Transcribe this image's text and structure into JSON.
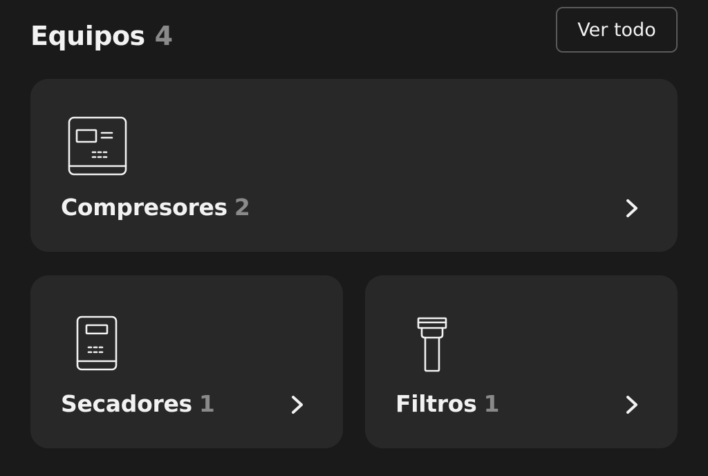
{
  "header": {
    "title": "Equipos",
    "count": "4",
    "view_all_label": "Ver todo"
  },
  "categories": [
    {
      "label": "Compresores",
      "count": "2",
      "icon": "compressor-icon"
    },
    {
      "label": "Secadores",
      "count": "1",
      "icon": "dryer-icon"
    },
    {
      "label": "Filtros",
      "count": "1",
      "icon": "filter-icon"
    }
  ],
  "colors": {
    "background": "#1a1a1a",
    "card": "#282828",
    "text": "#f2f2f2",
    "muted": "#8a8a8a",
    "border": "#5a5a5a"
  }
}
